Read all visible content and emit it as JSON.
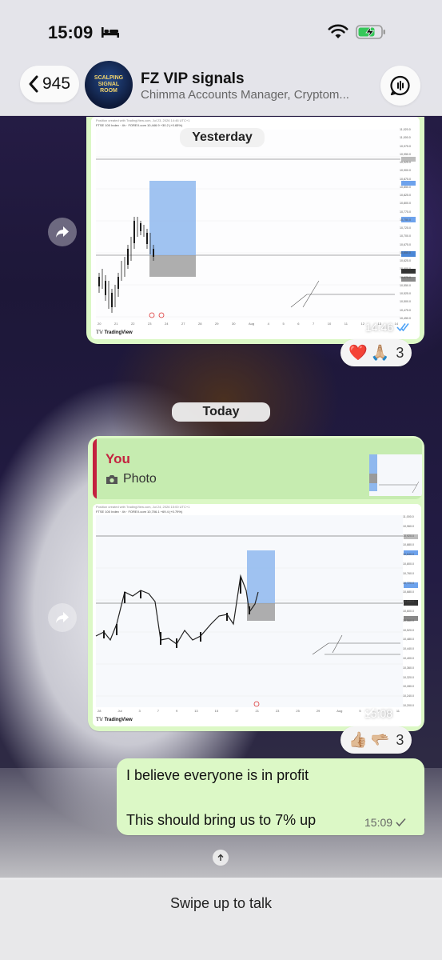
{
  "status_bar": {
    "time": "15:09",
    "focus_icon": "bed-icon",
    "wifi_icon": "wifi-icon",
    "battery_icon": "battery-charging-icon"
  },
  "header": {
    "back_count": "945",
    "avatar_text": "SCALPING SIGNAL ROOM",
    "title": "FZ VIP signals",
    "subtitle": "Chimma Accounts Manager, Cryptom..."
  },
  "messages": {
    "msg1": {
      "date_label": "Yesterday",
      "chart_caption": "Position created with TradingView.com, Jul 23, 2026 14:46 UTC+1",
      "chart_symbol": "FTSE 100 Index · 4h · FOREX.com  10,446.9  +30.2 (+0.65%)",
      "time": "14:46",
      "reactions": [
        "❤️",
        "🙏🏼"
      ],
      "reaction_count": "3",
      "tradingview_label": "TradingView",
      "price_ticks": [
        "11,020.0",
        "11,000.0",
        "10,975.0",
        "10,950.0",
        "10,925.0",
        "10,900.0",
        "10,875.0",
        "10,850.0",
        "10,825.0",
        "10,800.0",
        "10,775.0",
        "10,750.0",
        "10,725.0",
        "10,700.0",
        "10,675.0",
        "10,650.0",
        "10,625.0",
        "10,600.0",
        "10,575.0",
        "10,550.0",
        "10,525.0",
        "10,500.0",
        "10,475.0",
        "10,450.0"
      ],
      "date_ticks": [
        "20",
        "21",
        "22",
        "23",
        "24",
        "27",
        "28",
        "29",
        "30",
        "Aug",
        "4",
        "5",
        "6",
        "7",
        "10",
        "11",
        "12",
        "13",
        "14"
      ]
    },
    "msg2": {
      "date_label": "Today",
      "reply_name": "You",
      "reply_type": "Photo",
      "chart_caption": "Position created with TradingView.com, Jul 24, 2026 15:00 UTC+1",
      "chart_symbol": "FTSE 100 Index · 4h · FOREX.com  10,706.1  +69.4 (+0.79%)",
      "time": "15:08",
      "reactions": [
        "👍🏼",
        "🫳🏼"
      ],
      "reaction_count": "3",
      "tradingview_label": "TradingView",
      "price_ticks": [
        "11,000.0",
        "10,960.0",
        "10,920.0",
        "10,880.0",
        "10,840.0",
        "10,800.0",
        "10,760.0",
        "10,720.0",
        "10,680.0",
        "10,640.0",
        "10,600.0",
        "10,560.0",
        "10,520.0",
        "10,480.0",
        "10,440.0",
        "10,400.0",
        "10,360.0",
        "10,320.0",
        "10,280.0",
        "10,240.0",
        "10,200.0"
      ],
      "date_ticks": [
        "28",
        "Jul",
        "3",
        "7",
        "9",
        "13",
        "15",
        "17",
        "21",
        "23",
        "25",
        "29",
        "Aug",
        "5",
        "7",
        "11"
      ]
    },
    "msg3": {
      "line1": "I believe everyone is in profit",
      "line2": "This should bring us to 7% up",
      "time": "15:09"
    }
  },
  "composer": {
    "hint": "Swipe up to talk"
  },
  "colors": {
    "bubble": "#dcf8c6",
    "reply_accent": "#c4213f",
    "read_tick": "#4fa3f7",
    "position_target": "#8fb8ee",
    "position_stop": "#9a9a9a"
  }
}
